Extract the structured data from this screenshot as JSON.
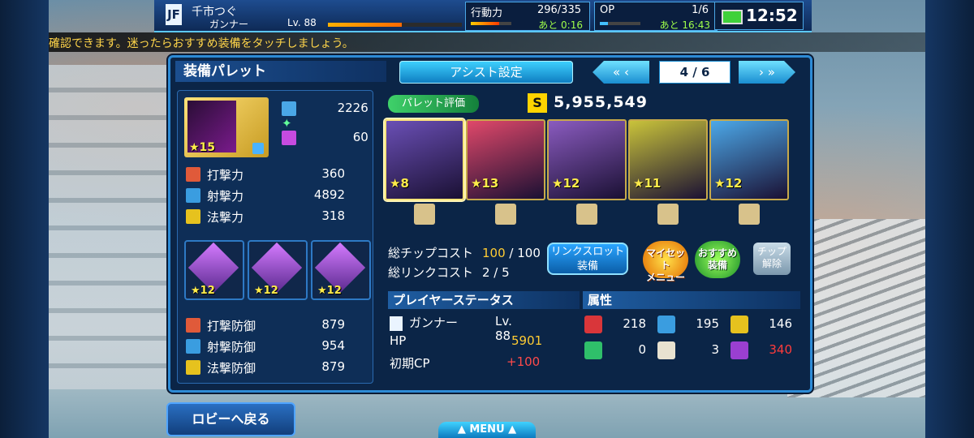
{
  "player": {
    "name": "千市つぐ",
    "class": "ガンナー",
    "level": "Lv. 88",
    "exp_fraction": 0.55
  },
  "ap": {
    "label": "行動力",
    "value": "296/335",
    "timer": "あと 0:16"
  },
  "op": {
    "label": "OP",
    "value": "1/6",
    "timer": "あと 16:43"
  },
  "clock": "12:52",
  "ticker": "確認できます。迷ったらおすすめ装備をタッチしましょう。",
  "panel": {
    "title": "装備パレット",
    "assist_label": "アシスト設定",
    "page": "4 / 6",
    "prev_arrow": "«  ‹",
    "next_arrow": "›  »"
  },
  "weapon": {
    "rarity": "★15",
    "stat1": "2226",
    "stat2": "60"
  },
  "attack_stats": [
    {
      "label": "打撃力",
      "value": "360"
    },
    {
      "label": "射撃力",
      "value": "4892"
    },
    {
      "label": "法撃力",
      "value": "318"
    }
  ],
  "sub_units": [
    "★12",
    "★12",
    "★12"
  ],
  "defense_stats": [
    {
      "label": "打撃防御",
      "value": "879"
    },
    {
      "label": "射撃防御",
      "value": "954"
    },
    {
      "label": "法撃防御",
      "value": "879"
    }
  ],
  "evaluation": {
    "label": "パレット評価",
    "icon": "S",
    "value": "5,955,549"
  },
  "chips": [
    {
      "rarity": "★8",
      "color": "#6a4fb5"
    },
    {
      "rarity": "★13",
      "color": "#e0486a"
    },
    {
      "rarity": "★12",
      "color": "#8a5bbf"
    },
    {
      "rarity": "★11",
      "color": "#c9c33a"
    },
    {
      "rarity": "★12",
      "color": "#4ca8e8"
    }
  ],
  "costs": {
    "chip_label": "総チップコスト",
    "chip_value": "100",
    "chip_max": "/ 100",
    "link_label": "総リンクコスト",
    "link_value": "2 / 5"
  },
  "buttons": {
    "link_slot": "リンクスロット\n装備",
    "myset": "マイセット\nメニュー",
    "recommend": "おすすめ\n装備",
    "chip_release": "チップ\n解除",
    "lobby": "ロビーへ戻る",
    "menu": "▲ MENU ▲"
  },
  "player_status": {
    "header": "プレイヤーステータス",
    "class": "ガンナー",
    "level": "Lv. 88",
    "hp_label": "HP",
    "hp_value": "5901",
    "cp_label": "初期CP",
    "cp_value": "+100"
  },
  "attributes": {
    "header": "属性",
    "values": [
      {
        "icon": "fire-icon",
        "value": "218",
        "color": "#d9363a"
      },
      {
        "icon": "ice-icon",
        "value": "195",
        "color": "#3a9de0"
      },
      {
        "icon": "lightning-icon",
        "value": "146",
        "color": "#e6c21e"
      },
      {
        "icon": "wind-icon",
        "value": "0",
        "color": "#2fbf6a"
      },
      {
        "icon": "light-icon",
        "value": "3",
        "color": "#e8e2d0"
      },
      {
        "icon": "dark-icon",
        "value": "340",
        "color": "#9a3fd1",
        "highlight": "#ff3b3b"
      }
    ]
  }
}
